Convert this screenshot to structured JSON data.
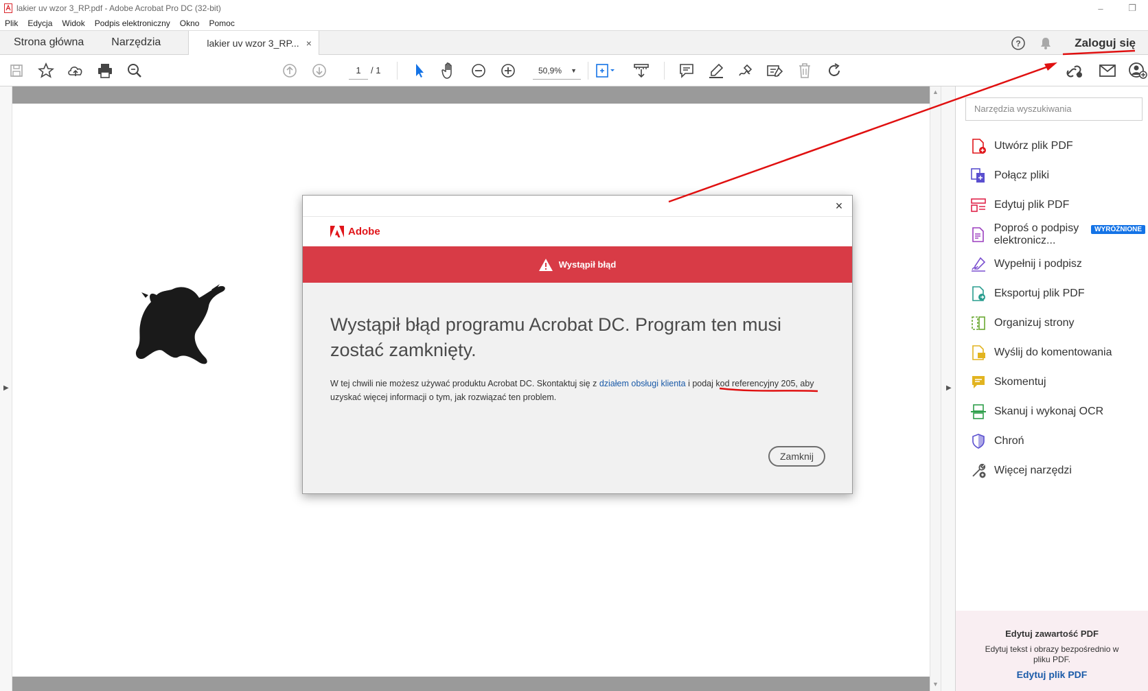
{
  "window": {
    "title": "lakier uv wzor 3_RP.pdf - Adobe Acrobat Pro DC (32-bit)",
    "minimize_icon": "minimize-icon",
    "restore_icon": "restore-icon"
  },
  "menu": [
    "Plik",
    "Edycja",
    "Widok",
    "Podpis elektroniczny",
    "Okno",
    "Pomoc"
  ],
  "tabs": {
    "home": "Strona główna",
    "tools": "Narzędzia",
    "document": "lakier uv wzor 3_RP...",
    "close": "×"
  },
  "header": {
    "signin": "Zaloguj się",
    "icons": [
      "help-icon",
      "bell-icon"
    ]
  },
  "toolbar": {
    "page_current": "1",
    "page_total": "/ 1",
    "zoom": "50,9%",
    "icons": [
      "save-icon",
      "star-icon",
      "upload-icon",
      "print-icon",
      "search-zoom-icon",
      "page-up-icon",
      "page-down-icon",
      "select-cursor-icon",
      "hand-icon",
      "zoom-out-icon",
      "zoom-in-icon",
      "fit-page-icon",
      "scroll-mode-icon",
      "comment-icon",
      "highlight-icon",
      "sign-icon",
      "fill-sign-icon",
      "delete-icon",
      "rotate-icon",
      "share-link-icon",
      "mail-icon",
      "add-user-icon"
    ]
  },
  "tools_pane": {
    "search_placeholder": "Narzędzia wyszukiwania",
    "badge": "WYRÓŻNIONE",
    "items": [
      {
        "label": "Utwórz plik PDF",
        "icon": "create-pdf-icon",
        "color": "#e0151a"
      },
      {
        "label": "Połącz pliki",
        "icon": "combine-files-icon",
        "color": "#5a4fcf"
      },
      {
        "label": "Edytuj plik PDF",
        "icon": "edit-pdf-icon",
        "color": "#e0244a"
      },
      {
        "label": "Poproś o podpisy elektronicz...",
        "icon": "request-signatures-icon",
        "color": "#9b3fbf"
      },
      {
        "label": "Wypełnij i podpisz",
        "icon": "fill-sign-icon",
        "color": "#7a4fcf"
      },
      {
        "label": "Eksportuj plik PDF",
        "icon": "export-pdf-icon",
        "color": "#2a9d8f"
      },
      {
        "label": "Organizuj strony",
        "icon": "organize-pages-icon",
        "color": "#6aa832"
      },
      {
        "label": "Wyślij do komentowania",
        "icon": "send-comment-icon",
        "color": "#e2b420"
      },
      {
        "label": "Skomentuj",
        "icon": "comment-icon",
        "color": "#e2b420"
      },
      {
        "label": "Skanuj i wykonaj OCR",
        "icon": "scan-ocr-icon",
        "color": "#2e9e4a"
      },
      {
        "label": "Chroń",
        "icon": "protect-icon",
        "color": "#5a4fcf"
      },
      {
        "label": "Więcej narzędzi",
        "icon": "more-tools-icon",
        "color": "#555555"
      }
    ],
    "promo": {
      "title": "Edytuj zawartość PDF",
      "text": "Edytuj tekst i obrazy bezpośrednio w pliku PDF.",
      "link": "Edytuj plik PDF"
    }
  },
  "dialog": {
    "brand": "Adobe",
    "banner": "Wystąpił błąd",
    "heading": "Wystąpił błąd programu Acrobat DC. Program ten musi zostać zamknięty.",
    "body_pre": "W tej chwili nie możesz używać produktu Acrobat DC. Skontaktuj się z ",
    "body_link": "działem obsługi klienta",
    "body_mid": " i podaj ",
    "body_ref": "kod referencyjny 205, aby",
    "body_post": " uzyskać więcej informacji o tym, jak rozwiązać ten problem.",
    "button": "Zamknij",
    "close": "×"
  },
  "colors": {
    "accent_red": "#d83b46",
    "adobe_red": "#e0151a",
    "link_blue": "#1a5aa8",
    "annotation_red": "#e01010",
    "selected_tool_blue": "#1473e6"
  }
}
